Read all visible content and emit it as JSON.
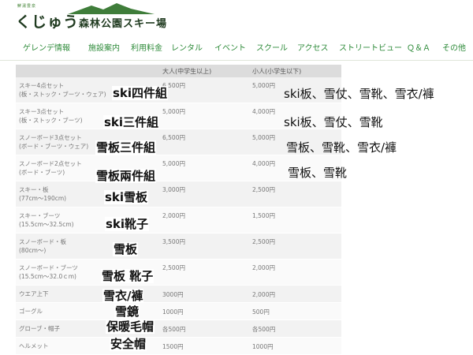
{
  "logo": {
    "small_text": "鮮湯豊泉",
    "main_text": "くじゅう",
    "sub_text": "森林公園スキー場"
  },
  "nav": [
    "ゲレンデ情報",
    "施設案内",
    "利用料金",
    "レンタル",
    "イベント",
    "スクール",
    "アクセス",
    "ストリートビュー",
    "Ｑ＆Ａ",
    "その他"
  ],
  "table": {
    "headers": {
      "adult": "大人(中学生以上)",
      "child": "小人(小学生以下)"
    },
    "rows": [
      {
        "item": [
          "スキー4点セット",
          "(板・ストック・ブーツ・ウェア)"
        ],
        "adult": "6,500円",
        "child": "5,000円"
      },
      {
        "item": [
          "スキー3点セット",
          "(板・ストック・ブーツ)"
        ],
        "adult": "5,000円",
        "child": "4,000円"
      },
      {
        "item": [
          "スノーボード3点セット",
          "(ボード・ブーツ・ウェア)"
        ],
        "adult": "6,500円",
        "child": "5,000円"
      },
      {
        "item": [
          "スノーボード2点セット",
          "(ボード・ブーツ)"
        ],
        "adult": "5,000円",
        "child": "4,000円"
      },
      {
        "item": [
          "スキー・板",
          "(77cm〜190cm)"
        ],
        "adult": "3,000円",
        "child": "2,500円"
      },
      {
        "item": [
          "スキー・ブーツ",
          "(15.5cm〜32.5cm)"
        ],
        "adult": "2,000円",
        "child": "1,500円"
      },
      {
        "item": [
          "スノーボード・板",
          "(80cm〜)"
        ],
        "adult": "3,500円",
        "child": "2,500円"
      },
      {
        "item": [
          "スノーボード・ブーツ",
          "(15.5cm〜32.0ｃm)"
        ],
        "adult": "2,500円",
        "child": "2,000円"
      },
      {
        "item": [
          "ウエア上下"
        ],
        "adult": "3000円",
        "child": "2,000円"
      },
      {
        "item": [
          "ゴーグル"
        ],
        "adult": "1000円",
        "child": "500円"
      },
      {
        "item": [
          "グローブ・帽子"
        ],
        "adult": "各500円",
        "child": "各500円"
      },
      {
        "item": [
          "ヘルメット"
        ],
        "adult": "1500円",
        "child": "1000円"
      }
    ]
  },
  "annotations": {
    "left": [
      "ski四件組",
      "ski三件組",
      "雪板三件組",
      "雪板兩件組",
      "ski雪板",
      "ski靴子",
      "雪板",
      "雪板 靴子",
      "雪衣/褲",
      "雪鏡",
      "保暖毛帽",
      "安全帽"
    ],
    "right": [
      "ski板、雪仗、雪靴、雪衣/褲",
      "ski板、雪仗、雪靴",
      "雪板、雪靴、雪衣/褲",
      "雪板、雪靴"
    ]
  },
  "colors": {
    "nav_text": "#2e8b3a",
    "header_row": "#dcdcdc",
    "row_odd": "#f2f2f2",
    "row_even": "#fafafa"
  }
}
